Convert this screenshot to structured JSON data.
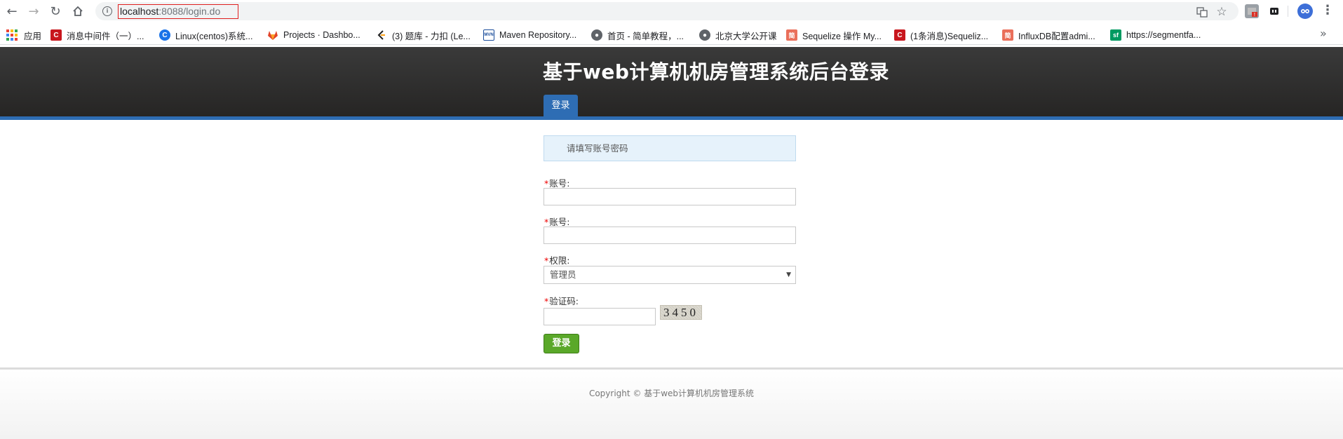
{
  "browser": {
    "url_host": "localhost",
    "url_rest": ":8088/login.do",
    "bookmarks": [
      {
        "label": "应用",
        "icon": "apps-grid-icon"
      },
      {
        "label": "消息中间件（一）...",
        "icon": "csdn-icon"
      },
      {
        "label": "Linux(centos)系统...",
        "icon": "link-icon"
      },
      {
        "label": "Projects · Dashbo...",
        "icon": "gitlab-icon"
      },
      {
        "label": "(3) 题库 - 力扣 (Le...",
        "icon": "leetcode-icon"
      },
      {
        "label": "Maven Repository...",
        "icon": "mvn-icon"
      },
      {
        "label": "首页 - 简单教程，...",
        "icon": "globe-icon"
      },
      {
        "label": "北京大学公开课",
        "icon": "globe-icon"
      },
      {
        "label": "Sequelize 操作 My...",
        "icon": "jianshu-icon"
      },
      {
        "label": "(1条消息)Sequeliz...",
        "icon": "csdn-icon"
      },
      {
        "label": "InfluxDB配置admi...",
        "icon": "jianshu-icon"
      },
      {
        "label": "https://segmentfa...",
        "icon": "segmentfault-icon"
      }
    ]
  },
  "header": {
    "title": "基于web计算机机房管理系统后台登录",
    "nav_tab": "登录"
  },
  "form": {
    "alert": "请填写账号密码",
    "required_mark": "*",
    "account_label": "账号:",
    "password_label": "账号:",
    "role_label": "权限:",
    "role_selected": "管理员",
    "captcha_label": "验证码:",
    "captcha_text": "3450",
    "submit_label": "登录"
  },
  "footer": {
    "copyright": "Copyright © 基于web计算机机房管理系统"
  }
}
